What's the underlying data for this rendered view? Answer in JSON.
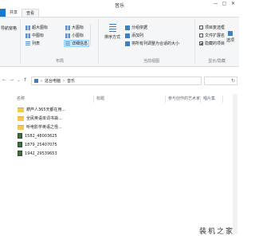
{
  "window": {
    "title": "音乐",
    "minimize": "—",
    "maximize": "▢",
    "close": "✕"
  },
  "tabs": [
    "",
    "共享",
    "查看"
  ],
  "ribbon": {
    "panes_label": "导航窗格",
    "layout": {
      "extra_large": "超大图标",
      "large": "大图标",
      "medium": "中图标",
      "small": "小图标",
      "list": "列表",
      "details": "详细信息",
      "group_label": "布局"
    },
    "current_view": {
      "sort_by": "排序方式",
      "group_by": "分组依据",
      "add_columns": "添加列",
      "size_columns": "将所有列调整为合适的大小",
      "group_label": "当前视图"
    },
    "show_hide": {
      "item_checkboxes": "项目复选框",
      "file_ext": "文件扩展名",
      "hidden_items": "隐藏的项目",
      "hidden_items_checked": true,
      "hide_selected": "隐藏所选项目",
      "group_label": "显示/隐藏"
    },
    "options": "选项"
  },
  "address": {
    "crumbs": [
      "这台电脑",
      "音乐"
    ],
    "separator": "›"
  },
  "columns": [
    "名称",
    "标题",
    "参与创作的艺术家",
    "唱片集"
  ],
  "files": [
    {
      "name": "葫芦人365天都在用...",
      "type": "folder"
    },
    {
      "name": "全民英语单词书袋...",
      "type": "folder"
    },
    {
      "name": "听电影学英语之怪...",
      "type": "folder"
    },
    {
      "name": "1582_48003625",
      "type": "audio"
    },
    {
      "name": "1879_25407075",
      "type": "audio"
    },
    {
      "name": "1942_29539653",
      "type": "audio"
    }
  ],
  "watermark": "装机之家"
}
